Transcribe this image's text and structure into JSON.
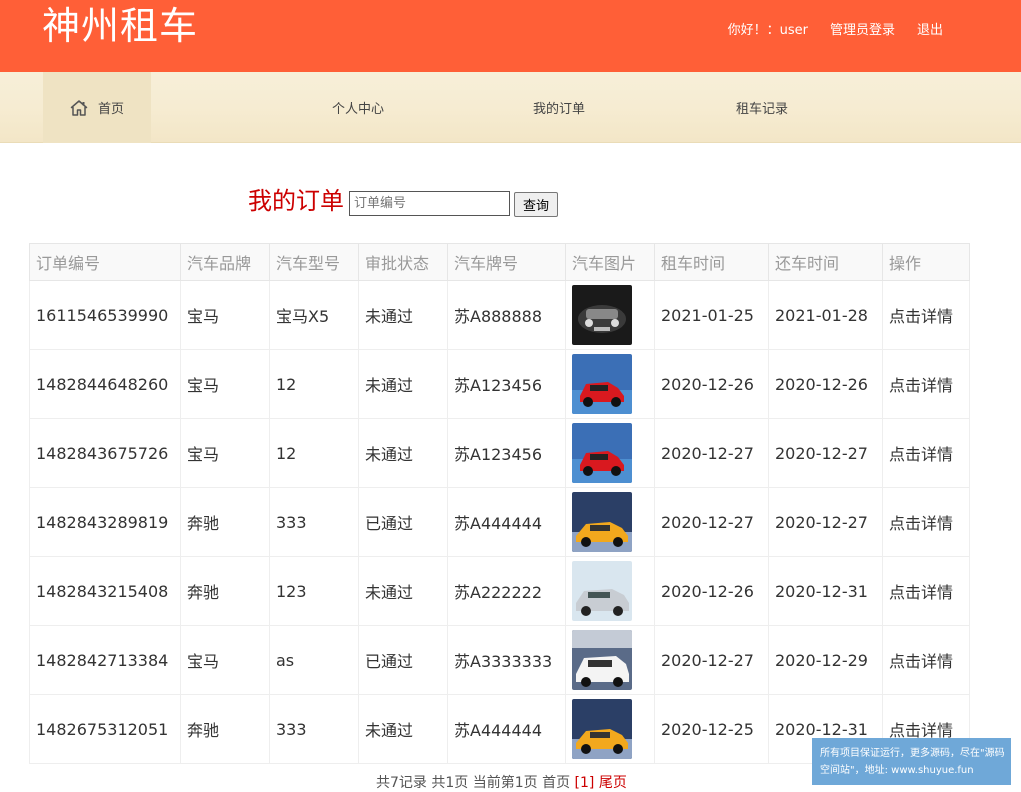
{
  "header": {
    "brand": "神州租车",
    "greeting": "你好！：user",
    "admin_login": "管理员登录",
    "logout": "退出"
  },
  "nav": {
    "home": "首页",
    "items": [
      "个人中心",
      "我的订单",
      "租车记录"
    ]
  },
  "search": {
    "title": "我的订单",
    "placeholder": "订单编号",
    "button": "查询"
  },
  "table": {
    "columns": [
      "订单编号",
      "汽车品牌",
      "汽车型号",
      "审批状态",
      "汽车牌号",
      "汽车图片",
      "租车时间",
      "还车时间",
      "操作"
    ],
    "rows": [
      {
        "id": "1611546539990",
        "brand": "宝马",
        "model": "宝马X5",
        "status": "未通过",
        "plate": "苏A888888",
        "image": "car-dark-front",
        "start": "2021-01-25",
        "end": "2021-01-28",
        "action": "点击详情"
      },
      {
        "id": "1482844648260",
        "brand": "宝马",
        "model": "12",
        "status": "未通过",
        "plate": "苏A123456",
        "image": "car-red",
        "start": "2020-12-26",
        "end": "2020-12-26",
        "action": "点击详情"
      },
      {
        "id": "1482843675726",
        "brand": "宝马",
        "model": "12",
        "status": "未通过",
        "plate": "苏A123456",
        "image": "car-red",
        "start": "2020-12-27",
        "end": "2020-12-27",
        "action": "点击详情"
      },
      {
        "id": "1482843289819",
        "brand": "奔驰",
        "model": "333",
        "status": "已通过",
        "plate": "苏A444444",
        "image": "car-yellow",
        "start": "2020-12-27",
        "end": "2020-12-27",
        "action": "点击详情"
      },
      {
        "id": "1482843215408",
        "brand": "奔驰",
        "model": "123",
        "status": "未通过",
        "plate": "苏A222222",
        "image": "car-silver",
        "start": "2020-12-26",
        "end": "2020-12-31",
        "action": "点击详情"
      },
      {
        "id": "1482842713384",
        "brand": "宝马",
        "model": "as",
        "status": "已通过",
        "plate": "苏A3333333",
        "image": "car-white",
        "start": "2020-12-27",
        "end": "2020-12-29",
        "action": "点击详情"
      },
      {
        "id": "1482675312051",
        "brand": "奔驰",
        "model": "333",
        "status": "未通过",
        "plate": "苏A444444",
        "image": "car-yellow",
        "start": "2020-12-25",
        "end": "2020-12-31",
        "action": "点击详情"
      }
    ]
  },
  "pager": {
    "summary": "共7记录 共1页 当前第1页 首页 ",
    "current": "[1]",
    "last": " 尾页"
  },
  "watermark": {
    "line1": "所有项目保证运行，更多源码，尽在\"源码",
    "line2": "空间站\"，地址: www.shuyue.fun"
  },
  "colors": {
    "header_bg": "#ff5f37",
    "title_red": "#cc0000",
    "nav_bg": "#f6ecd2",
    "watermark_bg": "#6fa8d8"
  }
}
